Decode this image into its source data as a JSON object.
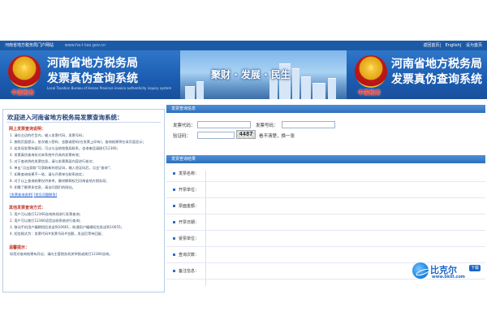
{
  "topbar": {
    "left_text": "河南省地方税务局门户网站",
    "url_text": "www.ha-l-tax.gov.cn",
    "right_links": [
      "返回首页",
      "English",
      "设为首页"
    ]
  },
  "banner": {
    "title_line1": "河南省地方税务局",
    "title_line2": "发票真伪查询系统",
    "subtitle": "Local Taxation Bureau of Henan Province invoice authenticity inquiry system",
    "seal_text": "中国税务",
    "slogan": "聚财 · 发展 · 民生",
    "right_title": "河南省地方税务局",
    "right_title2": "发票真伪查询系统"
  },
  "welcome": {
    "title": "欢迎进入河南省地方税务局发票查询系统：",
    "section1_title": "网上发票查询说明：",
    "section1_lines": [
      "1. 请在左边的栏目内，输入发票代码，发票号码；",
      "2. 按照页面提示，依次输入密码、金额或密码(在发票上印有)，查询结果将在本页面显示；",
      "3. 若发现发票有疑问，可以与当地地税局联系，咨询电话请拨打12366；",
      "4. 发票真伪查询仅对本系统中开具的发票有效；",
      "5. 对于查询到的发票信息，请与发票票面内容进行核对；",
      "6. 单击“点击获取”可获取新的验证码，输入验证码后，点击“查询”；",
      "7. 如果查询结果不一致，请与开票单位联系核实；",
      "8. 对于以上查询结果仅供参考，最终解释权归河南省地方税务局；",
      "9. 如需了解更多信息，请访问我们的网站。"
    ],
    "links": [
      "[发票查询说明]",
      "[常见问题解答]"
    ],
    "section2_title": "其他发票查询方式：",
    "section2_lines": [
      "1. 用户可以拨打12366咨询热线进行发票查询；",
      "2. 用户可以拨打12366语音自助系统进行查询；",
      "3. 移动手机用户编辑短信发送到10661，联通用户编辑短信发送到10655；",
      "4. 短信格式为：发票代码#发票号码#金额，发送后等待回复；"
    ],
    "section3_title": "温馨提示：",
    "section3_lines": [
      "如您对查询结果有异议，请向主管税务机关举报或拨打12366咨询。"
    ]
  },
  "query": {
    "header": "发票查询信息",
    "code_label": "发票代码：",
    "number_label": "发票号码：",
    "verify_label": "验证码：",
    "captcha": "4487",
    "refresh_text": "看不清楚，换一张"
  },
  "results": {
    "header": "发票查询结果",
    "rows": [
      "发票名称：",
      "开票单位：",
      "票面金额：",
      "开票日期：",
      "受票单位：",
      "查询次数：",
      "备注信息："
    ]
  },
  "watermark": {
    "name": "比克尔",
    "badge": "下载",
    "url": "www.bkill.com"
  },
  "colors": {
    "brand_blue": "#1d5aa6",
    "header_blue": "#2e6fbd",
    "accent_red": "#c0392b"
  }
}
